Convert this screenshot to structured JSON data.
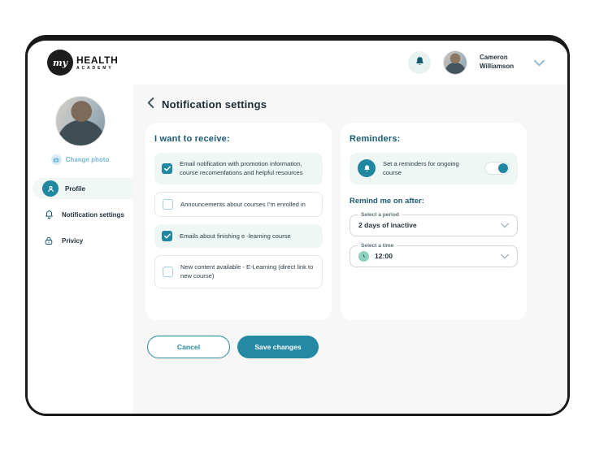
{
  "topbar": {
    "logo": {
      "monogram": "my",
      "line1": "HEALTH",
      "line2": "ACADEMY"
    },
    "user_name": "Cameron Williamson"
  },
  "sidebar": {
    "change_photo_label": "Change photo",
    "items": [
      {
        "label": "Profile",
        "icon": "user-icon",
        "active": true
      },
      {
        "label": "Notification settings",
        "icon": "bell-icon",
        "active": false
      },
      {
        "label": "Privicy",
        "icon": "lock-icon",
        "active": false
      }
    ]
  },
  "main": {
    "page_title": "Notification settings",
    "receive": {
      "heading": "I want to receive:",
      "options": [
        {
          "label": "Email notification with promotion information, course recomenfations and helpful resources",
          "checked": true
        },
        {
          "label": "Announcements about courses I'm enrolled in",
          "checked": false
        },
        {
          "label": "Emails about finishing e -learning course",
          "checked": true
        },
        {
          "label": "New content available - E-Learning (direct link to new course)",
          "checked": false
        }
      ]
    },
    "reminders": {
      "heading": "Reminders:",
      "toggle_label": "Set a reminders for ongoing course",
      "toggle_on": true,
      "remind_heading": "Remind me on after:",
      "period_field": {
        "label": "Select a period",
        "value": "2 days of inactive"
      },
      "time_field": {
        "label": "Select a time",
        "value": "12:00"
      }
    },
    "buttons": {
      "cancel": "Cancel",
      "save": "Save changes"
    }
  },
  "icons": {
    "topbar_bell": "bell-icon",
    "user_menu_chevron": "chevron-down-icon",
    "back": "chevron-left-icon",
    "camera": "camera-icon",
    "clock": "clock-icon",
    "check": "check-icon"
  },
  "colors": {
    "accent_teal": "#2489a3",
    "heading_teal": "#1b5a72",
    "checked_row_bg": "#eff7f5",
    "main_bg": "#f7f7f8",
    "frame_border": "#191919",
    "link_blue": "#76b9d8"
  }
}
